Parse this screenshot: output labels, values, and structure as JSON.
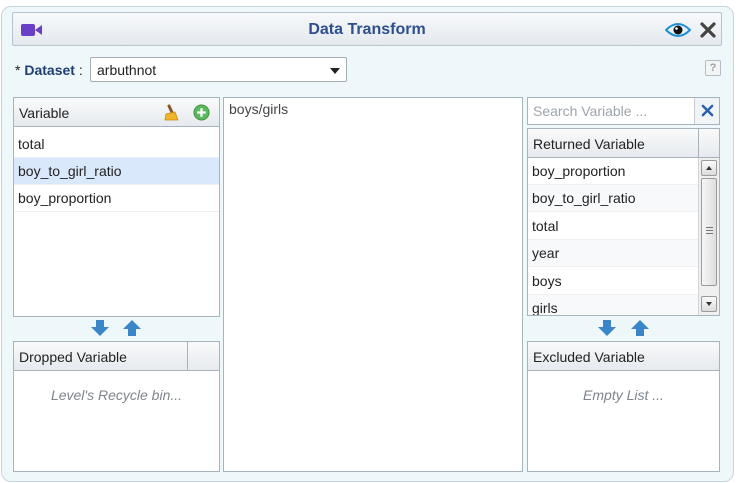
{
  "window": {
    "title": "Data Transform"
  },
  "dataset": {
    "required_mark": "*",
    "label": "Dataset",
    "colon": ":",
    "value": "arbuthnot",
    "help": "?"
  },
  "variable_panel": {
    "header": "Variable",
    "items": [
      "total",
      "boy_to_girl_ratio",
      "boy_proportion"
    ],
    "selected": "boy_to_girl_ratio"
  },
  "dropped_panel": {
    "header": "Dropped Variable",
    "empty_text": "Level's Recycle bin..."
  },
  "expression": {
    "text": "boys/girls"
  },
  "search": {
    "placeholder": "Search Variable ..."
  },
  "returned_panel": {
    "header": "Returned Variable",
    "items": [
      "boy_proportion",
      "boy_to_girl_ratio",
      "total",
      "year",
      "boys",
      "girls"
    ]
  },
  "excluded_panel": {
    "header": "Excluded Variable",
    "empty_text": "Empty List ..."
  },
  "icons": {
    "title": "video-camera-icon",
    "preview": "eye-icon",
    "close": "close-icon",
    "clear": "broom-icon",
    "add": "plus-circle-icon",
    "move_down": "arrow-down-icon",
    "move_up": "arrow-up-icon",
    "search_clear": "x-icon"
  },
  "colors": {
    "title": "#2d4f8c",
    "accent_purple": "#6a3fc8",
    "arrow_blue": "#3b86c9",
    "add_green": "#5cb85c",
    "selected_row": "#d9e8fb"
  }
}
